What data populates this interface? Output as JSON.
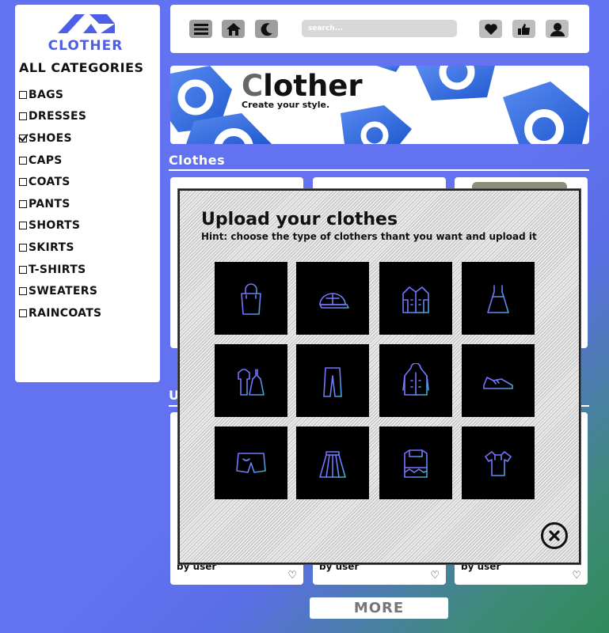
{
  "brand": {
    "name": "CLOTHER",
    "logo_icon": "clother-logo-icon"
  },
  "sidebar": {
    "title": "ALL CATEGORIES",
    "categories": [
      {
        "label": "BAGS",
        "checked": false
      },
      {
        "label": "DRESSES",
        "checked": false
      },
      {
        "label": "SHOES",
        "checked": true
      },
      {
        "label": "CAPS",
        "checked": false
      },
      {
        "label": "COATS",
        "checked": false
      },
      {
        "label": "PANTS",
        "checked": false
      },
      {
        "label": "SHORTS",
        "checked": false
      },
      {
        "label": "SKIRTS",
        "checked": false
      },
      {
        "label": "T-SHIRTS",
        "checked": false
      },
      {
        "label": "SWEATERS",
        "checked": false
      },
      {
        "label": "RAINCOATS",
        "checked": false
      }
    ]
  },
  "topbar": {
    "icons": [
      "menu-icon",
      "home-icon",
      "moon-icon"
    ],
    "search_placeholder": "search...",
    "right_icons": [
      "heart-icon",
      "thumbs-up-icon",
      "user-icon"
    ]
  },
  "banner": {
    "title_first": "C",
    "title_rest": "lother",
    "subtitle": "Create your style."
  },
  "sections": {
    "clothes_title": "Clothes",
    "second_title_partial": "U"
  },
  "cards": {
    "byline": "by user"
  },
  "more_label": "MORE",
  "modal": {
    "title": "Upload your clothes",
    "hint": "Hint: choose the type of clothers thant you want and upload it",
    "tiles": [
      "bag-icon",
      "cap-icon",
      "coat-icon",
      "dress-icon",
      "outfit-icon",
      "pants-icon",
      "raincoat-icon",
      "shoe-icon",
      "shorts-icon",
      "skirt-icon",
      "sweater-icon",
      "tshirt-icon"
    ],
    "close_icon": "close-icon"
  },
  "colors": {
    "background": "#6272f0",
    "accent": "#4d5fe6",
    "icon_stroke": "#6d7bff",
    "tile_bg": "#000000"
  }
}
